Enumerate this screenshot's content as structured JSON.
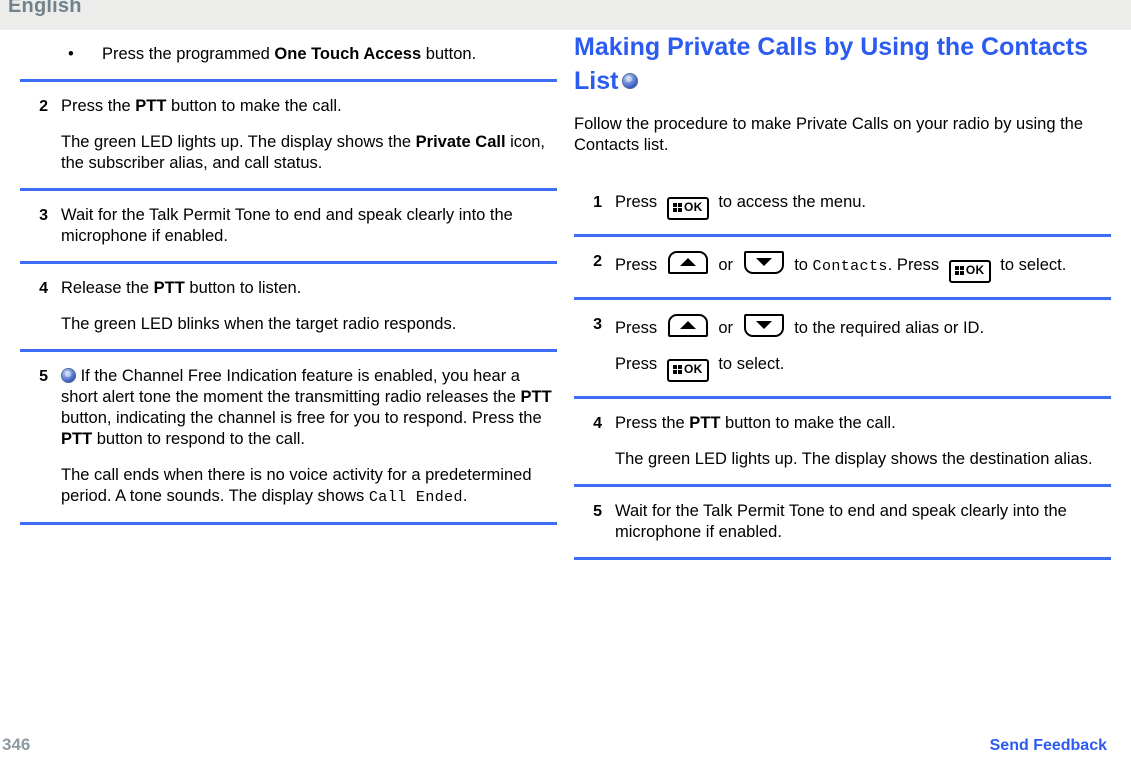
{
  "header": {
    "language": "English",
    "band_color": "#ececea",
    "text_color": "#70838c"
  },
  "theme": {
    "rule_color": "#3b6ef5",
    "heading_color": "#2b5bf0",
    "link_color": "#2b5bf0",
    "page_number_color": "#8c9aa3"
  },
  "left_column": {
    "bullet": {
      "marker": "•",
      "text_before": "Press the programmed ",
      "bold": "One Touch Access",
      "text_after": " button."
    },
    "steps": [
      {
        "number": "2",
        "lines": [
          {
            "parts": [
              {
                "t": "Press the "
              },
              {
                "t": "PTT",
                "b": true
              },
              {
                "t": " button to make the call."
              }
            ]
          },
          {
            "parts": [
              {
                "t": "The green LED lights up. The display shows the "
              },
              {
                "t": "Private Call",
                "b": true
              },
              {
                "t": " icon, the subscriber alias, and call status."
              }
            ]
          }
        ]
      },
      {
        "number": "3",
        "lines": [
          {
            "parts": [
              {
                "t": "Wait for the Talk Permit Tone to end and speak clearly into the microphone if enabled."
              }
            ]
          }
        ]
      },
      {
        "number": "4",
        "lines": [
          {
            "parts": [
              {
                "t": "Release the "
              },
              {
                "t": "PTT",
                "b": true
              },
              {
                "t": " button to listen."
              }
            ]
          },
          {
            "parts": [
              {
                "t": "The green LED blinks when the target radio responds."
              }
            ]
          }
        ]
      },
      {
        "number": "5",
        "lines": [
          {
            "icon": "note-sphere-icon",
            "parts": [
              {
                "t": " If the Channel Free Indication feature is enabled, you hear a short alert tone the moment the transmitting radio releases the "
              },
              {
                "t": "PTT",
                "b": true
              },
              {
                "t": " button, indicating the channel is free for you to respond. Press the "
              },
              {
                "t": "PTT",
                "b": true
              },
              {
                "t": " button to respond to the call."
              }
            ]
          },
          {
            "parts": [
              {
                "t": "The call ends when there is no voice activity for a predetermined period. A tone sounds. The display shows "
              },
              {
                "t": "Call Ended",
                "mono": true
              },
              {
                "t": "."
              }
            ]
          }
        ]
      }
    ]
  },
  "right_column": {
    "heading": "Making Private Calls by Using the Contacts List",
    "heading_icon": "note-sphere-icon",
    "intro": "Follow the procedure to make Private Calls on your radio by using the Contacts list.",
    "steps": [
      {
        "number": "1",
        "lines": [
          {
            "parts": [
              {
                "t": "Press "
              },
              {
                "key": "ok",
                "label": "OK"
              },
              {
                "t": " to access the menu."
              }
            ]
          }
        ]
      },
      {
        "number": "2",
        "lines": [
          {
            "parts": [
              {
                "t": "Press "
              },
              {
                "key": "up"
              },
              {
                "t": " or "
              },
              {
                "key": "down"
              },
              {
                "t": " to "
              },
              {
                "t": "Contacts",
                "mono": true
              },
              {
                "t": ". Press "
              },
              {
                "key": "ok",
                "label": "OK"
              },
              {
                "t": " to select."
              }
            ]
          }
        ]
      },
      {
        "number": "3",
        "lines": [
          {
            "parts": [
              {
                "t": "Press "
              },
              {
                "key": "up"
              },
              {
                "t": " or "
              },
              {
                "key": "down"
              },
              {
                "t": " to the required alias or ID."
              }
            ]
          },
          {
            "parts": [
              {
                "t": "Press "
              },
              {
                "key": "ok",
                "label": "OK"
              },
              {
                "t": " to select."
              }
            ]
          }
        ]
      },
      {
        "number": "4",
        "lines": [
          {
            "parts": [
              {
                "t": "Press the "
              },
              {
                "t": "PTT",
                "b": true
              },
              {
                "t": " button to make the call."
              }
            ]
          },
          {
            "parts": [
              {
                "t": "The green LED lights up. The display shows the destination alias."
              }
            ]
          }
        ]
      },
      {
        "number": "5",
        "lines": [
          {
            "parts": [
              {
                "t": "Wait for the Talk Permit Tone to end and speak clearly into the microphone if enabled."
              }
            ]
          }
        ]
      }
    ]
  },
  "footer": {
    "page_number": "346",
    "send_feedback": "Send Feedback"
  }
}
